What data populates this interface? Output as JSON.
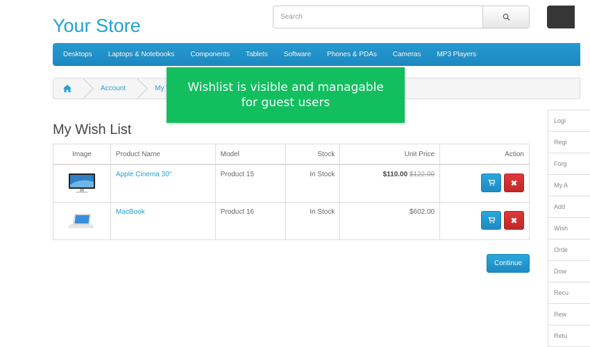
{
  "store": {
    "name": "Your Store"
  },
  "search": {
    "placeholder": "Search"
  },
  "menu": {
    "items": [
      "Desktops",
      "Laptops & Notebooks",
      "Components",
      "Tablets",
      "Software",
      "Phones & PDAs",
      "Cameras",
      "MP3 Players"
    ]
  },
  "breadcrumb": {
    "items": [
      "Account",
      "My Wi"
    ]
  },
  "tooltip": {
    "line1": "Wishlist is visible and managable",
    "line2": "for guest users"
  },
  "page": {
    "title": "My Wish List",
    "continue_label": "Continue"
  },
  "table": {
    "headers": [
      "Image",
      "Product Name",
      "Model",
      "Stock",
      "Unit Price",
      "Action"
    ],
    "rows": [
      {
        "name": "Apple Cinema 30\"",
        "model": "Product 15",
        "stock": "In Stock",
        "price": "$110.00",
        "old_price": "$122.00"
      },
      {
        "name": "MacBook",
        "model": "Product 16",
        "stock": "In Stock",
        "price": "$602.00",
        "old_price": ""
      }
    ]
  },
  "sidebar": {
    "items": [
      "Logi",
      "Regi",
      "Forg",
      "My A",
      "Add",
      "Wish",
      "Orde",
      "Dow",
      "Recu",
      "Rew",
      "Retu"
    ]
  },
  "colors": {
    "accent": "#23a1d1",
    "menu": "#229ad2",
    "tooltip": "#11bf5e",
    "remove": "#d9363a"
  }
}
